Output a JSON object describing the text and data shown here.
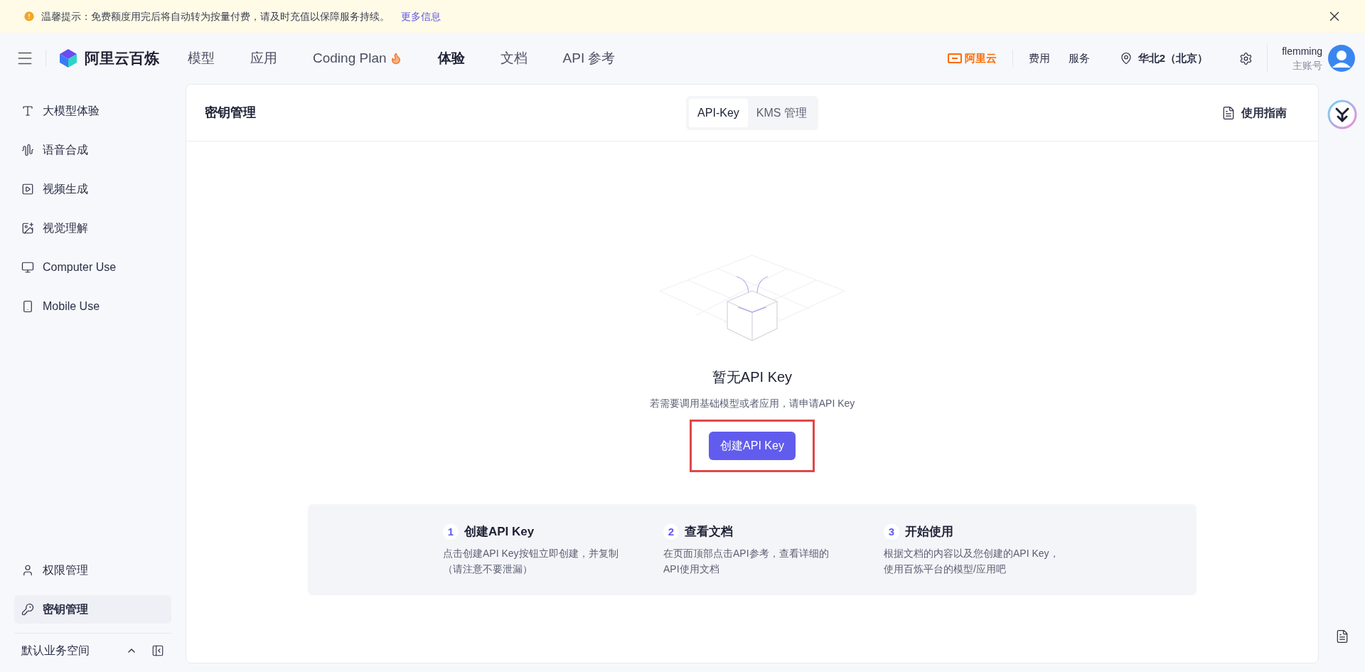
{
  "banner": {
    "text": "温馨提示：免费额度用完后将自动转为按量付费，请及时充值以保障服务持续。",
    "link": "更多信息"
  },
  "header": {
    "brand": "阿里云百炼",
    "nav": [
      {
        "label": "模型",
        "selected": false,
        "hot": false
      },
      {
        "label": "应用",
        "selected": false,
        "hot": false
      },
      {
        "label": "Coding Plan",
        "selected": false,
        "hot": true
      },
      {
        "label": "体验",
        "selected": true,
        "hot": false
      },
      {
        "label": "文档",
        "selected": false,
        "hot": false
      },
      {
        "label": "API 参考",
        "selected": false,
        "hot": false
      }
    ],
    "cloud_logo": "阿里云",
    "links": [
      "费用",
      "服务"
    ],
    "region": "华北2（北京）",
    "user": {
      "name": "flemming",
      "role": "主账号"
    }
  },
  "sidebar": {
    "items": [
      {
        "label": "大模型体验",
        "selected": false
      },
      {
        "label": "语音合成",
        "selected": false
      },
      {
        "label": "视频生成",
        "selected": false
      },
      {
        "label": "视觉理解",
        "selected": false
      },
      {
        "label": "Computer Use",
        "selected": false
      },
      {
        "label": "Mobile Use",
        "selected": false
      }
    ],
    "bottom_items": [
      {
        "label": "权限管理",
        "selected": false
      },
      {
        "label": "密钥管理",
        "selected": true
      }
    ],
    "workspace": "默认业务空间"
  },
  "card": {
    "title": "密钥管理",
    "tabs": [
      {
        "label": "API-Key",
        "selected": true
      },
      {
        "label": "KMS 管理",
        "selected": false
      }
    ],
    "guide": "使用指南",
    "empty": {
      "title": "暂无API Key",
      "subtitle": "若需要调用基础模型或者应用，请申请API Key",
      "button": "创建API Key"
    },
    "steps": [
      {
        "number": "1",
        "title": "创建API Key",
        "text": "点击创建API Key按钮立即创建，并复制（请注意不要泄漏）"
      },
      {
        "number": "2",
        "title": "查看文档",
        "text": "在页面顶部点击API参考，查看详细的API使用文档"
      },
      {
        "number": "3",
        "title": "开始使用",
        "text": "根据文档的内容以及您创建的API Key，使用百炼平台的模型/应用吧"
      }
    ]
  }
}
